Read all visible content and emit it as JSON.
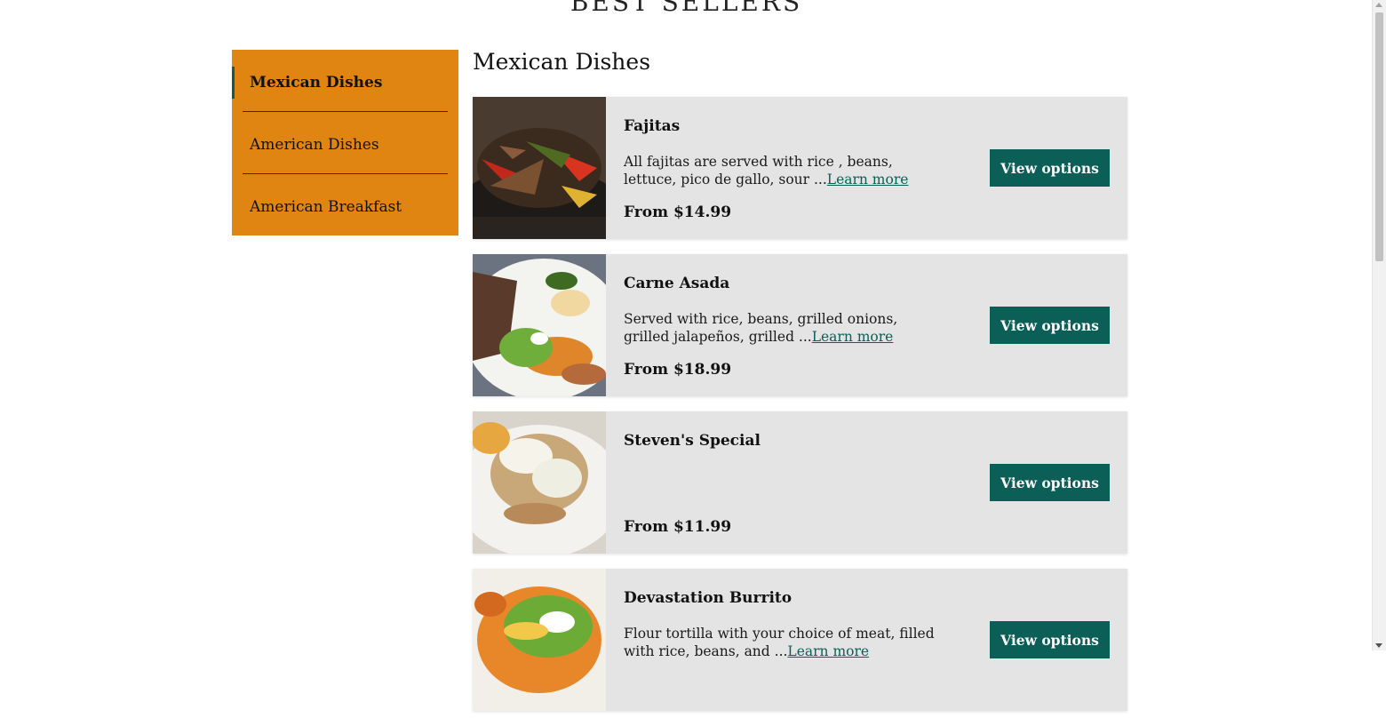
{
  "page": {
    "heading": "BEST SELLERS"
  },
  "nav": {
    "items": [
      {
        "label": "Mexican Dishes",
        "active": true
      },
      {
        "label": "American Dishes",
        "active": false
      },
      {
        "label": "American Breakfast",
        "active": false
      }
    ]
  },
  "section": {
    "title": "Mexican Dishes"
  },
  "dishes": [
    {
      "name": "Fajitas",
      "description": "All fajitas are served with rice , beans, lettuce, pico de gallo, sour ...",
      "learn_more": "Learn more",
      "price": "From $14.99",
      "button": "View options"
    },
    {
      "name": "Carne Asada",
      "description": "Served with rice, beans, grilled onions, grilled jalapeños, grilled ...",
      "learn_more": "Learn more",
      "price": "From $18.99",
      "button": "View options"
    },
    {
      "name": "Steven's Special",
      "description": "",
      "learn_more": "",
      "price": "From $11.99",
      "button": "View options"
    },
    {
      "name": "Devastation Burrito",
      "description": "Flour tortilla with your choice of meat, filled with rice, beans, and ...",
      "learn_more": "Learn more",
      "price": "",
      "button": "View options"
    }
  ],
  "colors": {
    "accent": "#0b5f57",
    "nav_bg": "#e08412",
    "card_bg": "#e4e4e4"
  }
}
